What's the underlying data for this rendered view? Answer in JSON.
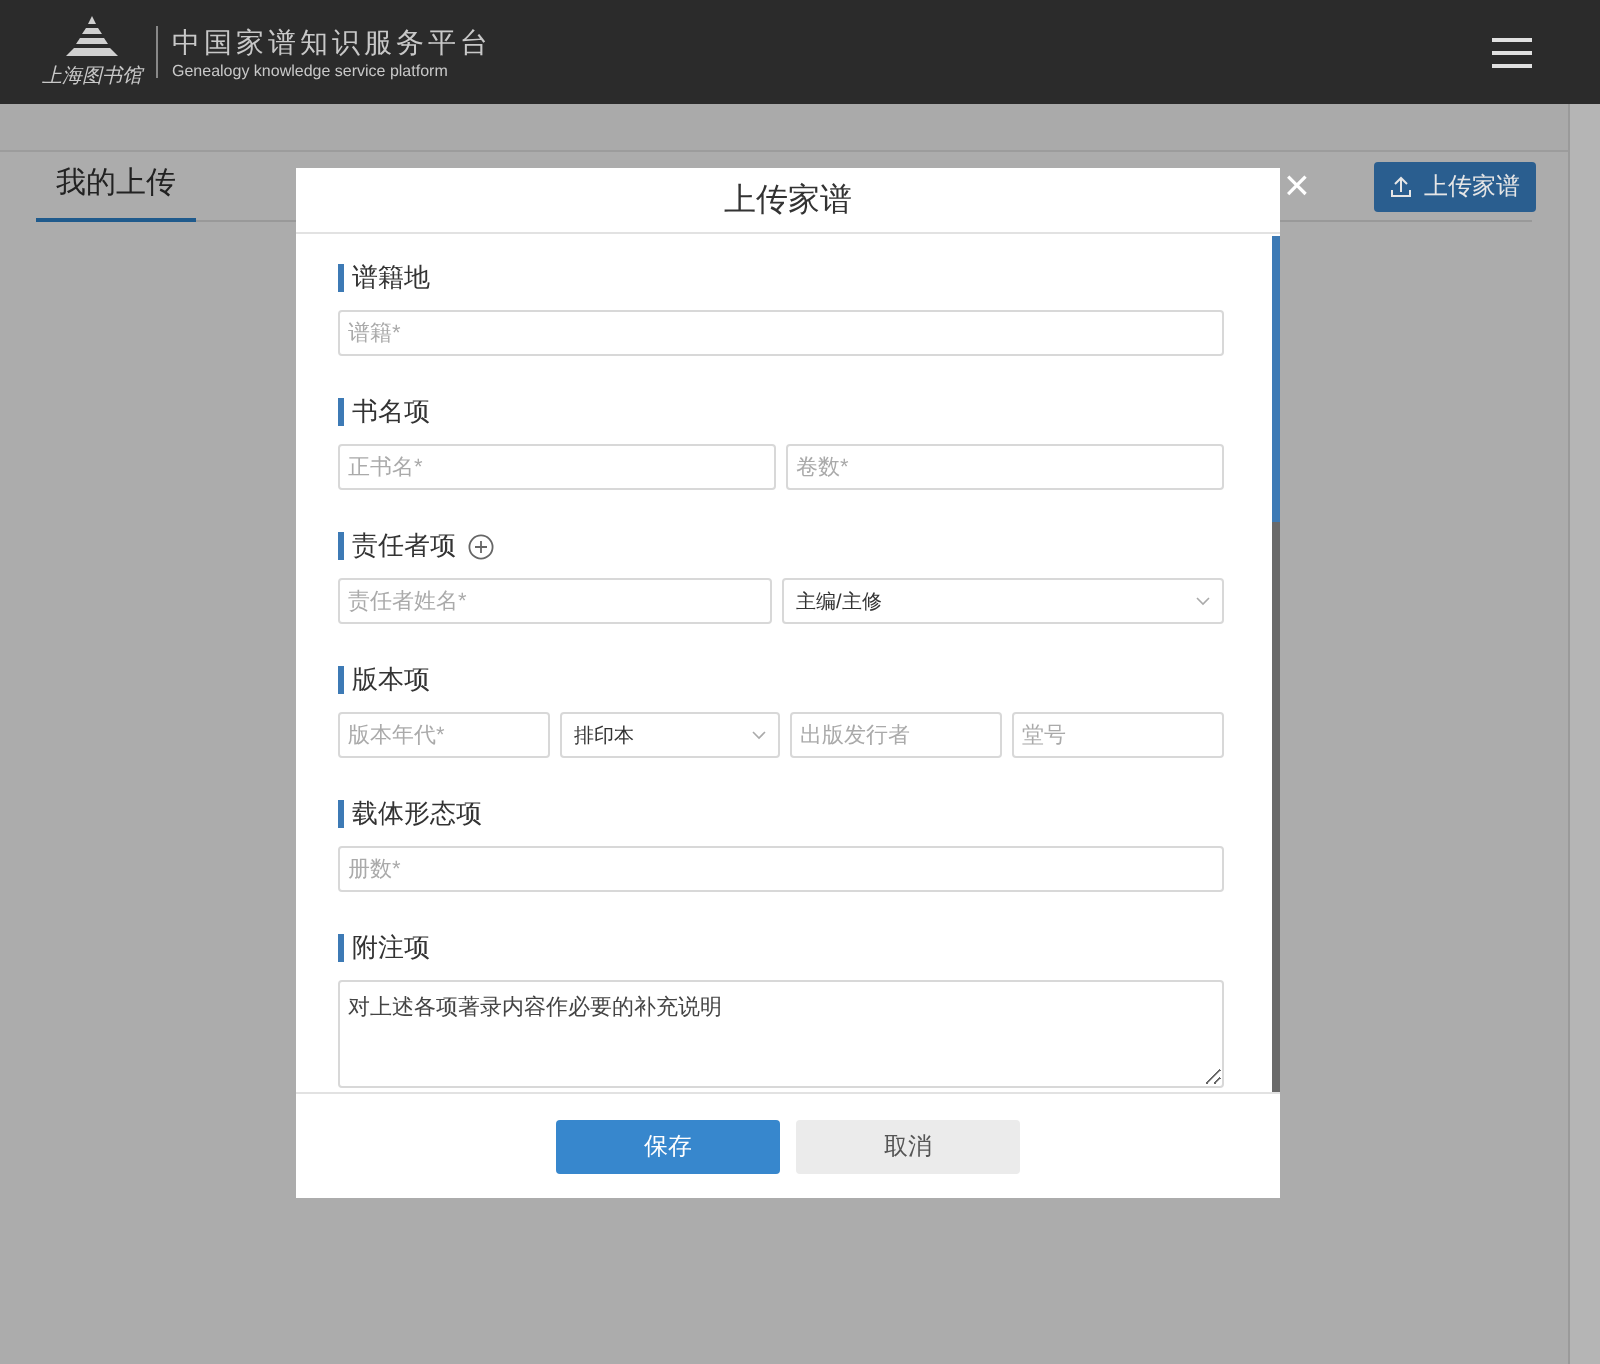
{
  "header": {
    "logo_text": "上海图书馆",
    "title": "中国家谱知识服务平台",
    "subtitle": "Genealogy knowledge service platform"
  },
  "page": {
    "tabs": [
      {
        "label": "我的上传",
        "selected": true
      }
    ],
    "upload_button": "上传家谱"
  },
  "dialog": {
    "title": "上传家谱",
    "close": "×",
    "sections": [
      {
        "title": "谱籍地",
        "addable": false,
        "fields": [
          {
            "kind": "input",
            "placeholder": "谱籍*"
          }
        ]
      },
      {
        "title": "书名项",
        "addable": false,
        "fields": [
          {
            "kind": "input",
            "placeholder": "正书名*"
          },
          {
            "kind": "input",
            "placeholder": "卷数*"
          }
        ]
      },
      {
        "title": "责任者项",
        "addable": true,
        "fields": [
          {
            "kind": "input",
            "placeholder": "责任者姓名*"
          },
          {
            "kind": "select",
            "value": "主编/主修"
          }
        ]
      },
      {
        "title": "版本项",
        "addable": false,
        "fields": [
          {
            "kind": "input",
            "placeholder": "版本年代*"
          },
          {
            "kind": "select",
            "value": "排印本"
          },
          {
            "kind": "input",
            "placeholder": "出版发行者"
          },
          {
            "kind": "input",
            "placeholder": "堂号"
          }
        ]
      },
      {
        "title": "载体形态项",
        "addable": false,
        "fields": [
          {
            "kind": "input",
            "placeholder": "册数*"
          }
        ]
      },
      {
        "title": "附注项",
        "addable": false,
        "fields": [
          {
            "kind": "textarea",
            "value": "对上述各项著录内容作必要的补充说明"
          }
        ]
      }
    ],
    "buttons": [
      {
        "label": "保存",
        "kind": "primary"
      },
      {
        "label": "取消",
        "kind": "secondary"
      }
    ]
  }
}
